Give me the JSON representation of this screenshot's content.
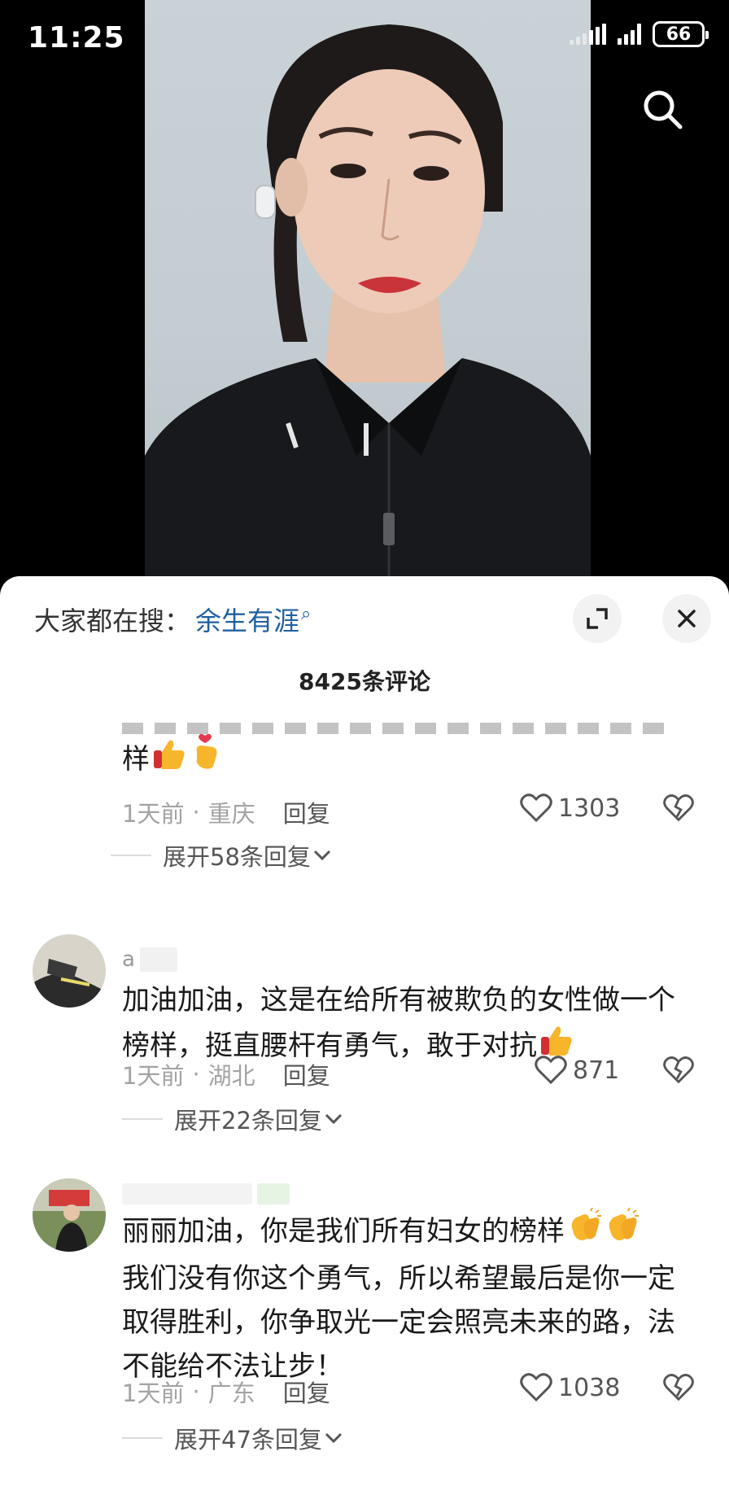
{
  "status": {
    "time": "11:25",
    "battery": "66"
  },
  "search_suggest": {
    "prefix": "大家都在搜：",
    "term": "余生有涯"
  },
  "comment_count": "8425条评论",
  "comments": [
    {
      "text": "样",
      "emojis": [
        "thumbs-up",
        "finger-heart"
      ],
      "time": "1天前",
      "location": "重庆",
      "reply_label": "回复",
      "likes": "1303",
      "expand_label": "展开58条回复"
    },
    {
      "username": "a",
      "text": "加油加油，这是在给所有被欺负的女性做一个榜样，挺直腰杆有勇气，敢于对抗",
      "emojis": [
        "thumbs-up"
      ],
      "time": "1天前",
      "location": "湖北",
      "reply_label": "回复",
      "likes": "871",
      "expand_label": "展开22条回复"
    },
    {
      "text_line1": "丽丽加油，你是我们所有妇女的榜样",
      "text_rest": "我们没有你这个勇气，所以希望最后是你一定取得胜利，你争取光一定会照亮未来的路，法不能给不法让步！",
      "emojis": [
        "clapping-hands",
        "clapping-hands"
      ],
      "time": "1天前",
      "location": "广东",
      "reply_label": "回复",
      "likes": "1038",
      "expand_label": "展开47条回复"
    }
  ],
  "colors": {
    "link": "#1f5fa0",
    "meta": "#a3a3a3",
    "sheet_bg": "#ffffff"
  }
}
